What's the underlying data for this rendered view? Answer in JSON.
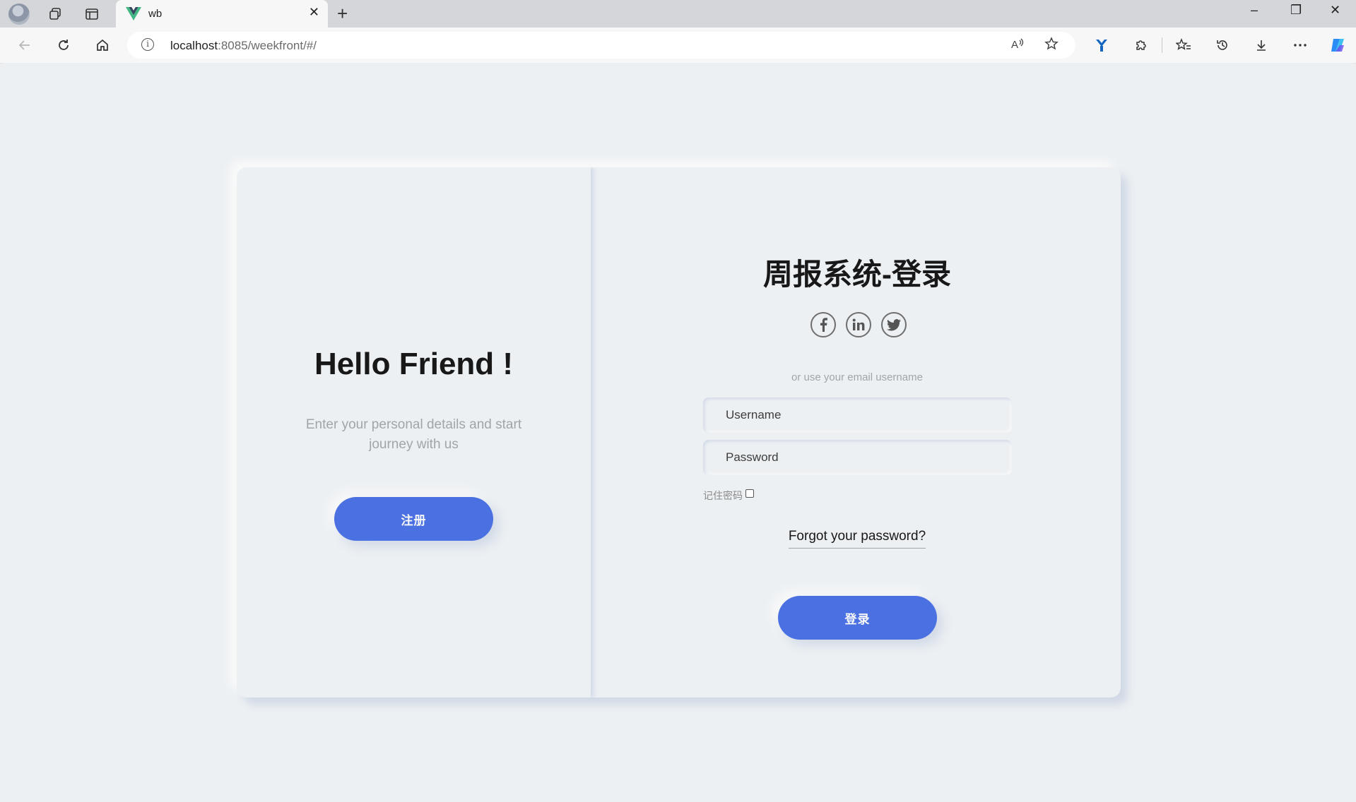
{
  "browser": {
    "tab_title": "wb",
    "url_host": "localhost",
    "url_rest": ":8085/weekfront/#/",
    "new_tab": "+",
    "tab_close": "✕",
    "window_minimize": "–",
    "window_restore": "❐",
    "window_close": "✕"
  },
  "left": {
    "heading": "Hello Friend !",
    "description": "Enter your personal details and start journey with us",
    "register_button": "注册"
  },
  "right": {
    "title": "周报系统-登录",
    "socials": [
      "facebook-icon",
      "linkedin-icon",
      "twitter-icon"
    ],
    "social_glyphs": [
      "f",
      "in",
      "🐦"
    ],
    "or_text": "or use your email username",
    "username_placeholder": "Username",
    "password_placeholder": "Password",
    "remember_label": "记住密码",
    "forgot_link": "Forgot your password?",
    "login_button": "登录"
  },
  "colors": {
    "background": "#ecf0f3",
    "primary_button": "#4b70e2",
    "muted_text": "#a0a5a8"
  }
}
